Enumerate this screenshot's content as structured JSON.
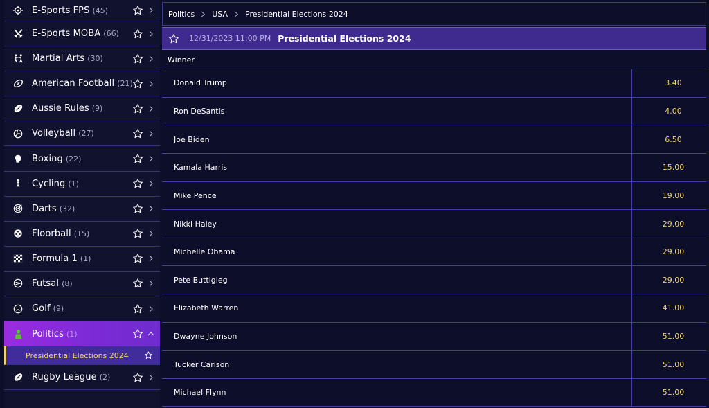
{
  "sidebar": {
    "items": [
      {
        "label": "E-Sports FPS",
        "count": "(45)",
        "icon": "crosshair-icon"
      },
      {
        "label": "E-Sports MOBA",
        "count": "(66)",
        "icon": "crossed-swords-icon"
      },
      {
        "label": "Martial Arts",
        "count": "(30)",
        "icon": "martial-arts-icon"
      },
      {
        "label": "American Football",
        "count": "(21)",
        "icon": "american-football-icon"
      },
      {
        "label": "Aussie Rules",
        "count": "(9)",
        "icon": "aussie-rules-ball-icon"
      },
      {
        "label": "Volleyball",
        "count": "(27)",
        "icon": "volleyball-icon"
      },
      {
        "label": "Boxing",
        "count": "(22)",
        "icon": "boxing-glove-icon"
      },
      {
        "label": "Cycling",
        "count": "(1)",
        "icon": "cycling-icon"
      },
      {
        "label": "Darts",
        "count": "(32)",
        "icon": "darts-target-icon"
      },
      {
        "label": "Floorball",
        "count": "(15)",
        "icon": "floorball-icon"
      },
      {
        "label": "Formula 1",
        "count": "(1)",
        "icon": "checkered-flag-icon"
      },
      {
        "label": "Futsal",
        "count": "(8)",
        "icon": "futsal-icon"
      },
      {
        "label": "Golf",
        "count": "(9)",
        "icon": "golf-ball-icon"
      },
      {
        "label": "Politics",
        "count": "(1)",
        "icon": "politics-person-icon",
        "active": true
      },
      {
        "label": "Rugby League",
        "count": "(2)",
        "icon": "rugby-ball-icon"
      }
    ],
    "sub_item": {
      "label": "Presidential Elections 2024"
    }
  },
  "breadcrumb": {
    "items": [
      "Politics",
      "USA",
      "Presidential Elections 2024"
    ]
  },
  "event": {
    "date": "12/31/2023 11:00 PM",
    "title": "Presidential Elections 2024"
  },
  "market": {
    "label": "Winner",
    "runners": [
      {
        "name": "Donald Trump",
        "price": "3.40"
      },
      {
        "name": "Ron DeSantis",
        "price": "4.00"
      },
      {
        "name": "Joe Biden",
        "price": "6.50"
      },
      {
        "name": "Kamala Harris",
        "price": "15.00"
      },
      {
        "name": "Mike Pence",
        "price": "19.00"
      },
      {
        "name": "Nikki Haley",
        "price": "29.00"
      },
      {
        "name": "Michelle Obama",
        "price": "29.00"
      },
      {
        "name": "Pete Buttigieg",
        "price": "29.00"
      },
      {
        "name": "Elizabeth Warren",
        "price": "41.00"
      },
      {
        "name": "Dwayne Johnson",
        "price": "51.00"
      },
      {
        "name": "Tucker Carlson",
        "price": "51.00"
      },
      {
        "name": "Michael Flynn",
        "price": "51.00"
      }
    ]
  },
  "colors": {
    "background": "#0d0e29",
    "accent_gold": "#f1d46a",
    "active_purple": "#9b2ce0",
    "header_purple": "#3f2b8e",
    "politics_icon_green": "#5fbf3a"
  }
}
